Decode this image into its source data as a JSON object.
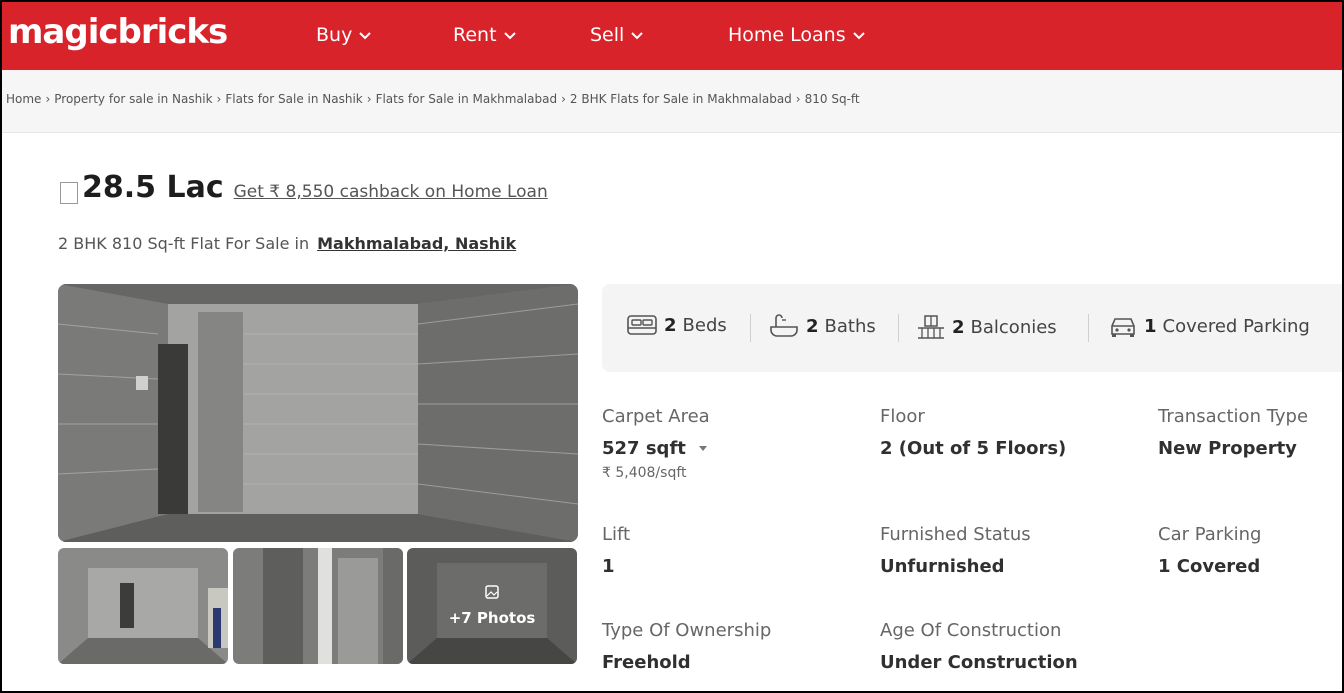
{
  "header": {
    "logo": "magicbricks",
    "nav": [
      {
        "label": "Buy"
      },
      {
        "label": "Rent"
      },
      {
        "label": "Sell"
      },
      {
        "label": "Home Loans"
      }
    ],
    "brand_color": "#d8232a"
  },
  "breadcrumb": [
    "Home",
    "Property for sale in Nashik",
    "Flats for Sale in Nashik",
    "Flats for Sale in Makhmalabad",
    "2 BHK Flats for Sale in Makhmalabad",
    "810 Sq-ft"
  ],
  "listing": {
    "price": "28.5 Lac",
    "cashback": "Get ₹ 8,550 cashback on Home Loan",
    "title_prefix": "2 BHK 810 Sq-ft Flat For Sale in",
    "locality": "Makhmalabad, Nashik"
  },
  "photos": {
    "more_label": "+7 Photos"
  },
  "amenities": [
    {
      "icon": "bed-icon",
      "count": "2",
      "label": "Beds"
    },
    {
      "icon": "bath-icon",
      "count": "2",
      "label": "Baths"
    },
    {
      "icon": "balcony-icon",
      "count": "2",
      "label": "Balconies"
    },
    {
      "icon": "car-icon",
      "count": "1",
      "label": "Covered Parking"
    }
  ],
  "details": {
    "carpet_area": {
      "label": "Carpet Area",
      "value": "527 sqft",
      "sub": "₹ 5,408/sqft"
    },
    "floor": {
      "label": "Floor",
      "value": "2 (Out of 5 Floors)"
    },
    "transaction": {
      "label": "Transaction Type",
      "value": "New Property"
    },
    "lift": {
      "label": "Lift",
      "value": "1"
    },
    "furnished": {
      "label": "Furnished Status",
      "value": "Unfurnished"
    },
    "car_parking": {
      "label": "Car Parking",
      "value": "1 Covered"
    },
    "ownership": {
      "label": "Type Of Ownership",
      "value": "Freehold"
    },
    "age": {
      "label": "Age Of Construction",
      "value": "Under Construction"
    }
  }
}
